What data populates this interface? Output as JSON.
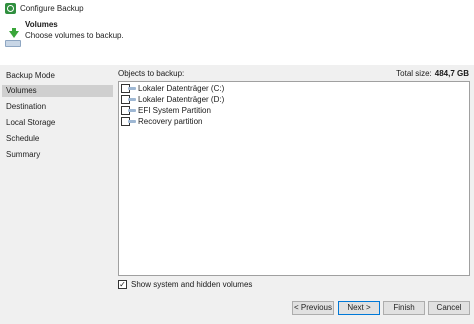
{
  "window": {
    "title": "Configure Backup",
    "icon": "veeam-app-icon"
  },
  "header": {
    "title": "Volumes",
    "subtitle": "Choose volumes to backup.",
    "icon": "download-to-drive-icon"
  },
  "sidebar": {
    "items": [
      {
        "label": "Backup Mode",
        "active": false
      },
      {
        "label": "Volumes",
        "active": true
      },
      {
        "label": "Destination",
        "active": false
      },
      {
        "label": "Local Storage",
        "active": false
      },
      {
        "label": "Schedule",
        "active": false
      },
      {
        "label": "Summary",
        "active": false
      }
    ]
  },
  "main": {
    "objects_label": "Objects to backup:",
    "total_size_label": "Total size:",
    "total_size_value": "484,7 GB",
    "volumes": [
      {
        "label": "Lokaler Datenträger (C:)",
        "checked": false,
        "icon": "disk-volume-icon"
      },
      {
        "label": "Lokaler Datenträger (D:)",
        "checked": false,
        "icon": "disk-volume-icon"
      },
      {
        "label": "EFI System Partition",
        "checked": false,
        "icon": "disk-volume-icon"
      },
      {
        "label": "Recovery partition",
        "checked": false,
        "icon": "disk-volume-icon"
      }
    ],
    "show_hidden": {
      "label": "Show system and hidden volumes",
      "checked": true
    }
  },
  "footer": {
    "previous_label": "< Previous",
    "next_label": "Next >",
    "finish_label": "Finish",
    "cancel_label": "Cancel"
  },
  "colors": {
    "accent": "#0078d7",
    "brand": "#2f8f3e",
    "sidebar_bg": "#f0f0f0",
    "active_item": "#cfcfcf"
  }
}
